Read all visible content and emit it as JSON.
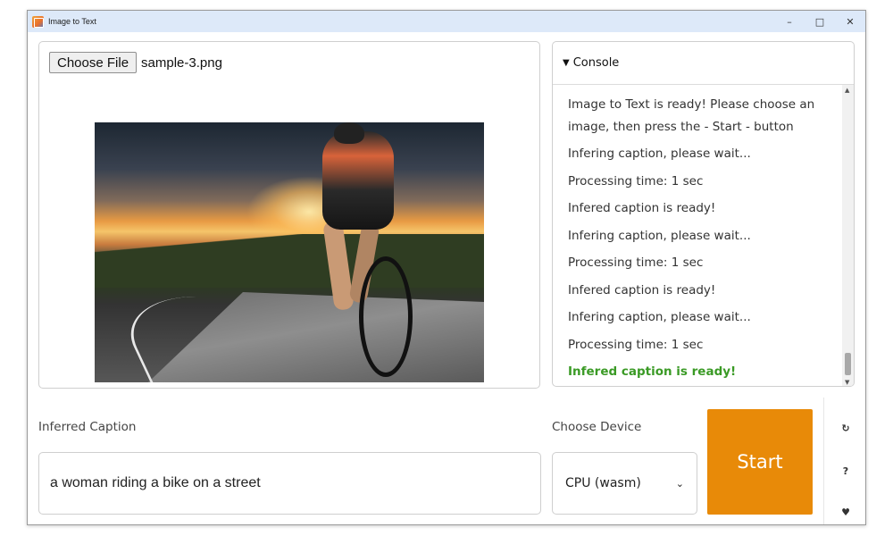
{
  "window": {
    "title": "Image to Text",
    "controls": {
      "minimize": "–",
      "maximize": "□",
      "close": "✕"
    }
  },
  "file_input": {
    "button_label": "Choose File",
    "file_name": "sample-3.png"
  },
  "console": {
    "header": "Console",
    "caret": "▼",
    "lines": [
      "Image to Text is ready! Please choose an image, then press the - Start - button",
      "Infering caption, please wait...",
      "Processing time: 1 sec",
      "Infered caption is ready!",
      "Infering caption, please wait...",
      "Processing time: 1 sec",
      "Infered caption is ready!",
      "Infering caption, please wait...",
      "Processing time: 1 sec",
      "Infered caption is ready!"
    ],
    "last_line_color": "#3a9a25"
  },
  "caption": {
    "label": "Inferred Caption",
    "value": "a woman riding a bike on a street"
  },
  "device": {
    "label": "Choose Device",
    "selected": "CPU (wasm)"
  },
  "start_button": {
    "label": "Start",
    "color": "#e88a08"
  },
  "side_toolbar": {
    "refresh": "↻",
    "help": "?",
    "favorite": "♥"
  }
}
